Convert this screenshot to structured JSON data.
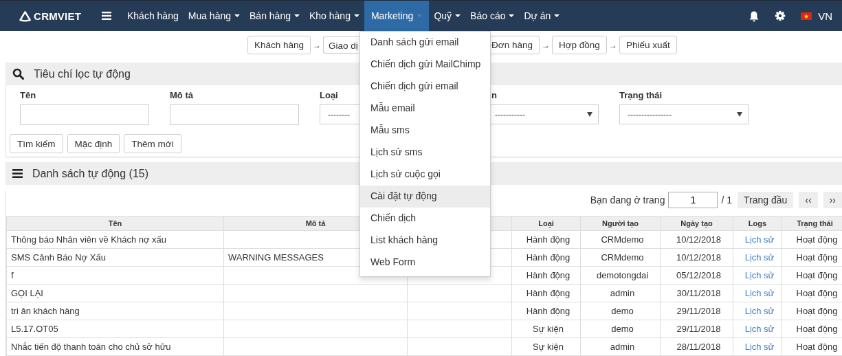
{
  "navbar": {
    "logo": "CRMVIET",
    "items": [
      {
        "label": "Khách hàng",
        "caret": false,
        "selected": false
      },
      {
        "label": "Mua hàng",
        "caret": true,
        "selected": false
      },
      {
        "label": "Bán hàng",
        "caret": true,
        "selected": false
      },
      {
        "label": "Kho hàng",
        "caret": true,
        "selected": false
      },
      {
        "label": "Marketing",
        "caret": true,
        "selected": true
      },
      {
        "label": "Quỹ",
        "caret": true,
        "selected": false
      },
      {
        "label": "Báo cáo",
        "caret": true,
        "selected": false
      },
      {
        "label": "Dự án",
        "caret": true,
        "selected": false
      }
    ],
    "language": "VN"
  },
  "marketing_menu": [
    {
      "label": "Danh sách gửi email",
      "selected": false
    },
    {
      "label": "Chiến dịch gửi MailChimp",
      "selected": false
    },
    {
      "label": "Chiến dịch gửi email",
      "selected": false
    },
    {
      "label": "Mẫu email",
      "selected": false
    },
    {
      "label": "Mẫu sms",
      "selected": false
    },
    {
      "label": "Lịch sử sms",
      "selected": false
    },
    {
      "label": "Lịch sử cuộc gọi",
      "selected": false
    },
    {
      "label": "Cài đặt tự động",
      "selected": true
    },
    {
      "label": "Chiến dịch",
      "selected": false
    },
    {
      "label": "List khách hàng",
      "selected": false
    },
    {
      "label": "Web Form",
      "selected": false
    }
  ],
  "workflow": [
    {
      "label": "Khách hàng"
    },
    {
      "arrow": "→",
      "label": "Giao dị"
    },
    {
      "label": "Đơn hàng"
    },
    {
      "arrow": "→",
      "label": "Hợp đồng"
    },
    {
      "arrow": "→",
      "label": "Phiếu xuất"
    }
  ],
  "filter_panel": {
    "title": "Tiêu chí lọc tự động",
    "fields": [
      {
        "kind": "input",
        "label": "Tên"
      },
      {
        "kind": "input",
        "label": "Mô tả"
      },
      {
        "kind": "select",
        "label": "Loại",
        "value": "--------"
      },
      {
        "kind": "select",
        "label": "n",
        "value": "-----------"
      },
      {
        "kind": "select",
        "label": "Trạng thái",
        "value": "----------------"
      }
    ],
    "buttons": [
      "Tìm kiếm",
      "Mặc định",
      "Thêm mới"
    ]
  },
  "list_panel": {
    "title": "Danh sách tự động (15)",
    "pagination": {
      "prefix": "Bạn đang ở trang",
      "page": "1",
      "total": "/ 1",
      "first": "Trang đầu",
      "prev": "‹‹",
      "next": "››"
    },
    "table": {
      "columns": [
        "Tên",
        "Mô tả",
        "",
        "Loại",
        "Người tạo",
        "Ngày tạo",
        "Logs",
        "Trạng thái"
      ],
      "rows": [
        [
          "Thông báo Nhân viên về Khách nợ xấu",
          "",
          "",
          "Hành động",
          "CRMdemo",
          "10/12/2018",
          "Lịch sử",
          "Hoạt động"
        ],
        [
          "SMS Cảnh Báo Nợ Xấu",
          "WARNING MESSAGES",
          "",
          "Hành động",
          "CRMdemo",
          "10/12/2018",
          "Lịch sử",
          "Hoạt động"
        ],
        [
          "f",
          "",
          "",
          "Hành động",
          "demotongdai",
          "05/12/2018",
          "Lịch sử",
          "Hoạt động"
        ],
        [
          "GỌI LẠI",
          "",
          "",
          "Hành động",
          "admin",
          "30/11/2018",
          "Lịch sử",
          "Hoạt động"
        ],
        [
          "tri ân khách hàng",
          "",
          "",
          "Hành động",
          "demo",
          "29/11/2018",
          "Lịch sử",
          "Hoạt động"
        ],
        [
          "L5.17.OT05",
          "",
          "",
          "Sự kiện",
          "demo",
          "29/11/2018",
          "Lịch sử",
          "Hoạt động"
        ],
        [
          "Nhắc tiến độ thanh toán cho chủ sở hữu",
          "",
          "",
          "Sự kiện",
          "admin",
          "28/11/2018",
          "Lịch sử",
          "Hoạt động"
        ]
      ]
    }
  }
}
